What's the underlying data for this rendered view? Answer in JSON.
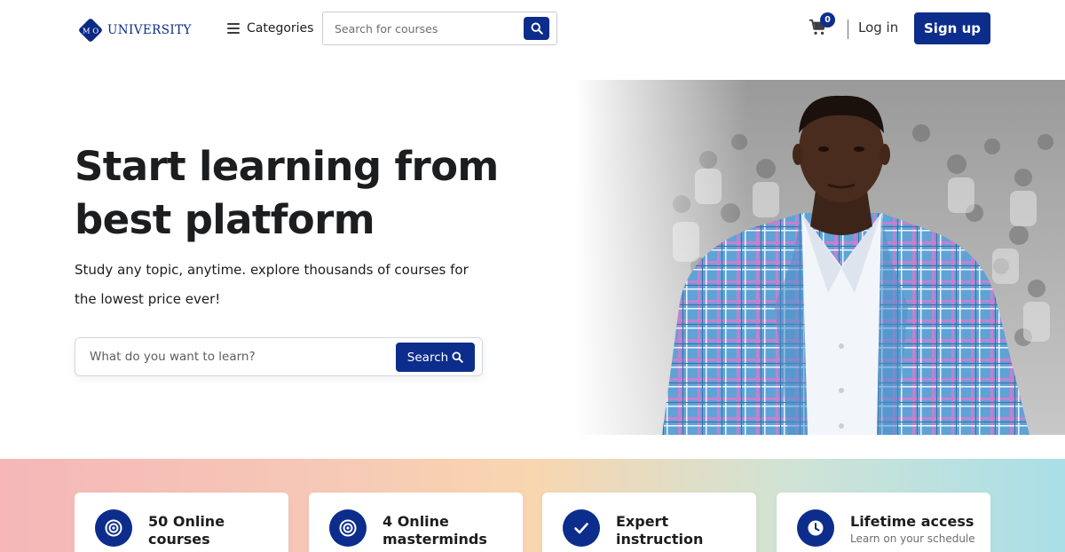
{
  "header": {
    "logo": {
      "mark_text": "M O",
      "name": "UNIVERSITY"
    },
    "categories_label": "Categories",
    "search": {
      "placeholder": "Search for courses"
    },
    "cart": {
      "count": "0"
    },
    "login_label": "Log in",
    "signup_label": "Sign up"
  },
  "hero": {
    "title": "Start learning from best platform",
    "subtitle": "Study any topic, anytime. explore thousands of courses for the lowest price ever!",
    "search": {
      "placeholder": "What do you want to learn?",
      "button_label": "Search"
    }
  },
  "features": [
    {
      "icon": "target-icon",
      "title": "50 Online courses",
      "subtitle": ""
    },
    {
      "icon": "target-icon",
      "title": "4 Online masterminds",
      "subtitle": ""
    },
    {
      "icon": "check-icon",
      "title": "Expert instruction",
      "subtitle": ""
    },
    {
      "icon": "clock-icon",
      "title": "Lifetime access",
      "subtitle": "Learn on your schedule"
    }
  ],
  "colors": {
    "brand": "#0d2d8c",
    "text": "#1c1d1f",
    "muted": "#6a6f73"
  }
}
